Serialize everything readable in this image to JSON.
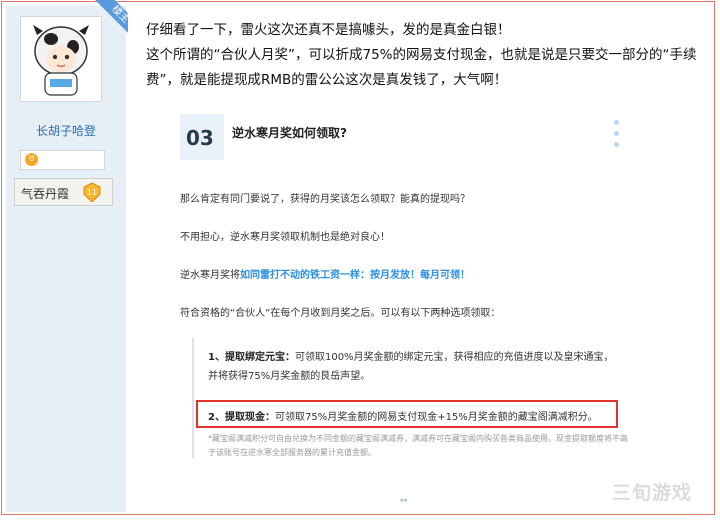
{
  "user": {
    "badge_label": "楼主",
    "username": "长胡子哈登",
    "medal_glyph": "♉",
    "rank_label": "气吞丹霞",
    "level": "11"
  },
  "post": {
    "line1": "仔细看了一下，雷火这次还真不是搞噱头，发的是真金白银！",
    "line2": "这个所谓的“合伙人月奖”，可以折成75%的网易支付现金，也就是说是只要交一部分的“手续费”，就是能提现成RMB的雷公公这次是真发钱了，大气啊！"
  },
  "article": {
    "section_number": "03",
    "section_title": "逆水寒月奖如何领取?",
    "p1": "那么肯定有同门要说了，获得的月奖该怎么领取？能真的提现吗？",
    "p2": "不用担心，逆水寒月奖领取机制也是绝对良心！",
    "p3_prefix": "逆水寒月奖将",
    "p3_highlight": "如同雷打不动的铁工资一样：按月发放！每月可领！",
    "p4": "符合资格的“合伙人”在每个月收到月奖之后。可以有以下两种选项领取：",
    "opt1_title": "1、提取绑定元宝：",
    "opt1_text": "可领取100%月奖金额的绑定元宝，获得相应的充值进度以及皇宋通宝，并将获得75%月奖金额的艮岳声望。",
    "opt2_title": "2、提取现金：",
    "opt2_text": "可领取75%月奖金额的网易支付现金+15%月奖金额的藏宝阁满减积分。",
    "note": "*藏宝阁满减积分可自由兑换为不同金额的藏宝阁满减券，满减券可在藏宝阁内购买各类商品使用。现金提取额度将不高于该账号在逆水寒全部服务器的累计充值金额。"
  },
  "footer_mark": "↔",
  "watermark": "三旬游戏",
  "colors": {
    "accent_blue": "#2c8fe0",
    "highlight_red": "#e0312b",
    "sidebar_bg": "#e6eef6"
  }
}
